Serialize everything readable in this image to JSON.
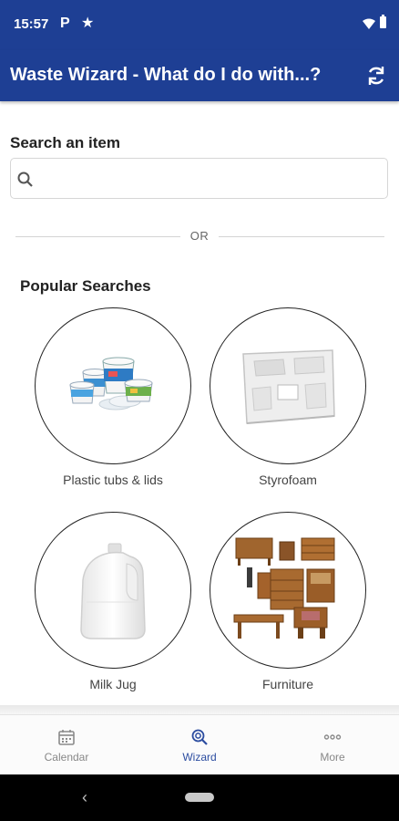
{
  "status_bar": {
    "time": "15:57",
    "app_indicator": "P",
    "notification_icon": "star-icon",
    "wifi_icon": "wifi-icon",
    "battery_icon": "battery-icon"
  },
  "app_bar": {
    "title": "Waste Wizard - What do I do with...?",
    "refresh_icon": "refresh-icon",
    "background": "#1e3f94"
  },
  "search": {
    "label": "Search an item",
    "value": "",
    "placeholder": "",
    "icon": "search-icon"
  },
  "divider": {
    "text": "OR"
  },
  "popular": {
    "title": "Popular Searches",
    "items": [
      {
        "label": "Plastic tubs & lids",
        "image": "plastic-tubs-image"
      },
      {
        "label": "Styrofoam",
        "image": "styrofoam-image"
      },
      {
        "label": "Milk Jug",
        "image": "milk-jug-image"
      },
      {
        "label": "Furniture",
        "image": "furniture-image"
      }
    ]
  },
  "bottom_nav": {
    "items": [
      {
        "label": "Calendar",
        "icon": "calendar-icon",
        "active": false
      },
      {
        "label": "Wizard",
        "icon": "wizard-search-icon",
        "active": true
      },
      {
        "label": "More",
        "icon": "more-icon",
        "active": false
      }
    ],
    "active_color": "#2c4da0"
  },
  "system_nav": {
    "back_icon": "back-icon",
    "home_icon": "home-pill-icon"
  }
}
